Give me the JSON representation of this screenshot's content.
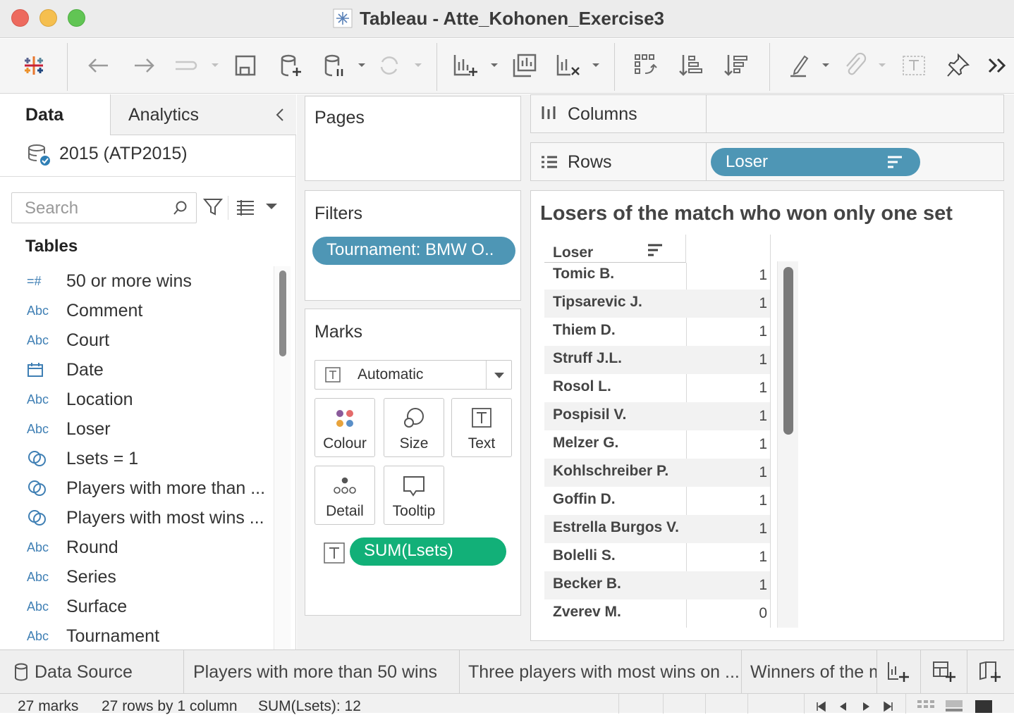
{
  "window": {
    "title": "Tableau - Atte_Kohonen_Exercise3"
  },
  "left_panel": {
    "tabs": [
      {
        "label": "Data"
      },
      {
        "label": "Analytics"
      }
    ],
    "data_source": "2015 (ATP2015)",
    "search_placeholder": "Search",
    "tables_heading": "Tables",
    "fields": [
      {
        "type": "=#",
        "label": "50 or more wins"
      },
      {
        "type": "Abc",
        "label": "Comment"
      },
      {
        "type": "Abc",
        "label": "Court"
      },
      {
        "type": "calendar",
        "label": "Date"
      },
      {
        "type": "Abc",
        "label": "Location"
      },
      {
        "type": "Abc",
        "label": "Loser"
      },
      {
        "type": "set",
        "label": "Lsets = 1"
      },
      {
        "type": "set",
        "label": "Players with more than ..."
      },
      {
        "type": "set",
        "label": "Players with most wins ..."
      },
      {
        "type": "Abc",
        "label": "Round"
      },
      {
        "type": "Abc",
        "label": "Series"
      },
      {
        "type": "Abc",
        "label": "Surface"
      },
      {
        "type": "Abc",
        "label": "Tournament"
      }
    ]
  },
  "pages": {
    "title": "Pages"
  },
  "filters": {
    "title": "Filters",
    "pill": "Tournament: BMW O.."
  },
  "marks": {
    "title": "Marks",
    "type": "Automatic",
    "cards": [
      "Colour",
      "Size",
      "Text",
      "Detail",
      "Tooltip"
    ],
    "pill": "SUM(Lsets)"
  },
  "shelves": {
    "columns_label": "Columns",
    "rows_label": "Rows",
    "rows_pill": "Loser"
  },
  "view": {
    "title": "Losers of the match who won only one set",
    "header": "Loser",
    "rows": [
      {
        "name": "Tomic B.",
        "value": "1"
      },
      {
        "name": "Tipsarevic J.",
        "value": "1"
      },
      {
        "name": "Thiem D.",
        "value": "1"
      },
      {
        "name": "Struff J.L.",
        "value": "1"
      },
      {
        "name": "Rosol L.",
        "value": "1"
      },
      {
        "name": "Pospisil V.",
        "value": "1"
      },
      {
        "name": "Melzer G.",
        "value": "1"
      },
      {
        "name": "Kohlschreiber P.",
        "value": "1"
      },
      {
        "name": "Goffin D.",
        "value": "1"
      },
      {
        "name": "Estrella Burgos V.",
        "value": "1"
      },
      {
        "name": "Bolelli S.",
        "value": "1"
      },
      {
        "name": "Becker B.",
        "value": "1"
      },
      {
        "name": "Zverev M.",
        "value": "0"
      }
    ]
  },
  "sheet_tabs": [
    "Data Source",
    "Players with more than 50 wins",
    "Three players with most wins on ...",
    "Winners of the m"
  ],
  "status": {
    "marks": "27 marks",
    "rows": "27 rows by 1 column",
    "sum": "SUM(Lsets): 12"
  },
  "colors": {
    "rows_pill": "#4e96b5",
    "filter_pill": "#4e96b5",
    "measure_pill": "#12b078",
    "field_icon": "#3f7fb4"
  }
}
